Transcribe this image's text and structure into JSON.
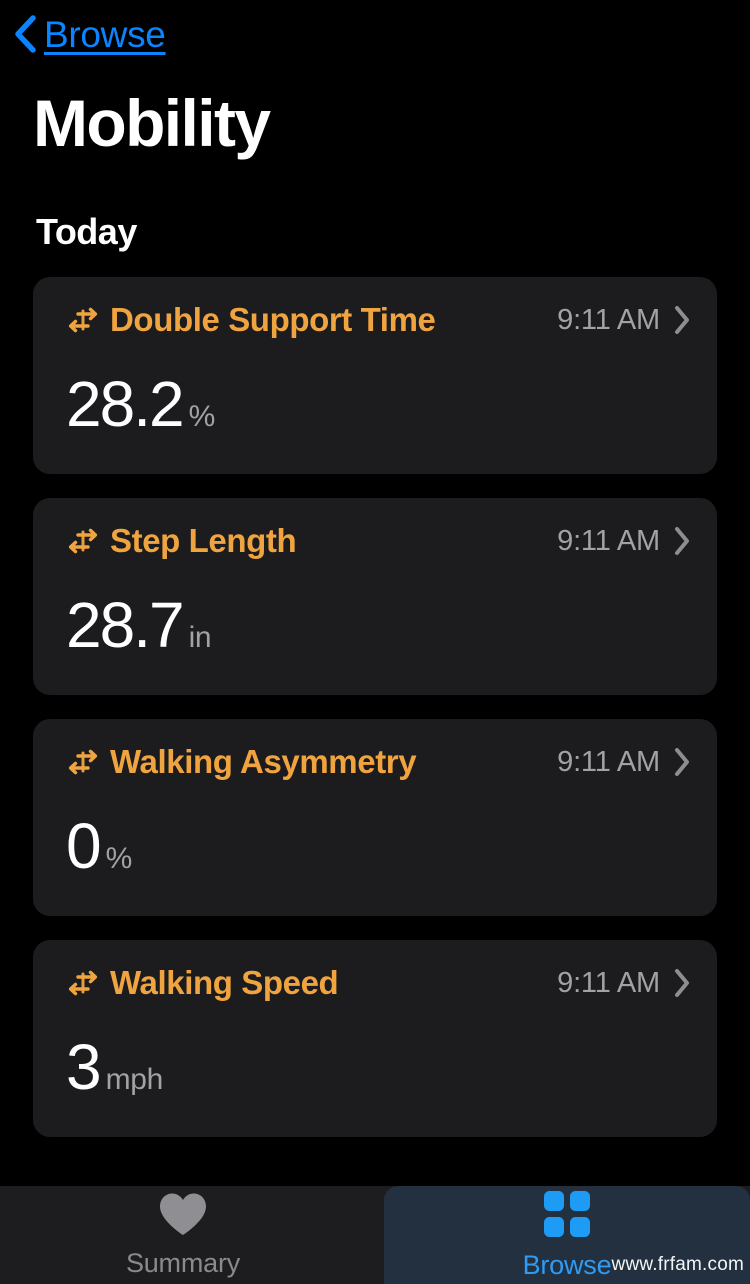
{
  "nav": {
    "back_label": "Browse",
    "back_icon": "chevron-left-icon",
    "accent_color": "#0a84ff"
  },
  "header": {
    "title": "Mobility"
  },
  "section": {
    "label": "Today"
  },
  "theme": {
    "background": "#000000",
    "card_background": "#1c1c1e",
    "title_accent": "#f0a43f",
    "secondary_text": "#a1a1a6",
    "tab_selected_background": "#22303f",
    "tab_active_text": "#2f9bf4",
    "tab_inactive_text": "#8a8a8e"
  },
  "metrics": [
    {
      "icon": "motion-arrows-icon",
      "title": "Double Support Time",
      "time": "9:11 AM",
      "chevron": "chevron-right-icon",
      "value": "28.2",
      "unit": "%"
    },
    {
      "icon": "motion-arrows-icon",
      "title": "Step Length",
      "time": "9:11 AM",
      "chevron": "chevron-right-icon",
      "value": "28.7",
      "unit": "in"
    },
    {
      "icon": "motion-arrows-icon",
      "title": "Walking Asymmetry",
      "time": "9:11 AM",
      "chevron": "chevron-right-icon",
      "value": "0",
      "unit": "%"
    },
    {
      "icon": "motion-arrows-icon",
      "title": "Walking Speed",
      "time": "9:11 AM",
      "chevron": "chevron-right-icon",
      "value": "3",
      "unit": "mph"
    }
  ],
  "tabs": [
    {
      "label": "Summary",
      "icon": "heart-icon",
      "selected": false
    },
    {
      "label": "Browse",
      "icon": "grid-squares-icon",
      "selected": true
    }
  ],
  "watermark": {
    "text": "www.frfam.com"
  }
}
